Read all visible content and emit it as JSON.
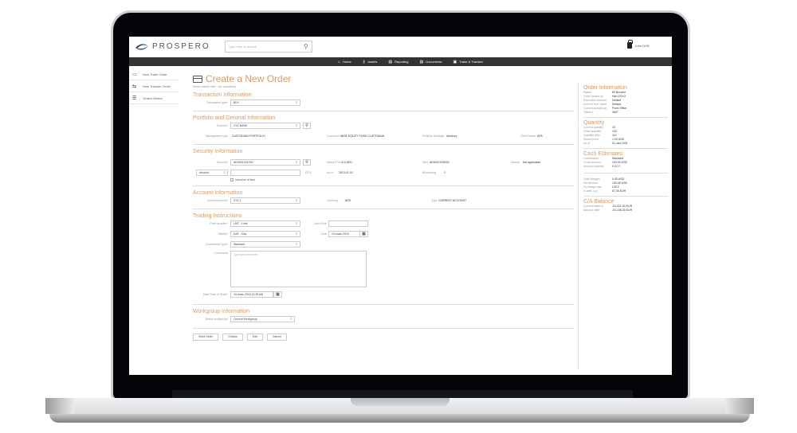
{
  "app": {
    "brand": "PROSPERO",
    "search_placeholder": "Type here to search",
    "user_name": "John DOE"
  },
  "nav": [
    {
      "icon": "home-icon",
      "glyph": "⌂",
      "label": "Home"
    },
    {
      "icon": "key-icon",
      "glyph": "⚷",
      "label": "Assets"
    },
    {
      "icon": "report-icon",
      "glyph": "▤",
      "label": "Reporting"
    },
    {
      "icon": "document-icon",
      "glyph": "▤",
      "label": "Documents"
    },
    {
      "icon": "briefcase-icon",
      "glyph": "▣",
      "label": "Trade & Transfer"
    }
  ],
  "sidebar": [
    {
      "icon": "card-icon",
      "glyph": "▭",
      "label": "New Trade Order"
    },
    {
      "icon": "transfer-icon",
      "glyph": "⇆",
      "label": "New Transfer Order"
    },
    {
      "icon": "list-icon",
      "glyph": "☰",
      "label": "Orders Blotter"
    }
  ],
  "page": {
    "title": "Create a New Order",
    "mandatory_note": "Items marked with * are mandatory"
  },
  "transaction": {
    "title": "Transaction Information",
    "type_label": "Transaction type*",
    "type_value": "BUY"
  },
  "portfolio": {
    "title": "Portfolio and General Information",
    "portfolio_label": "Portfolio*",
    "portfolio_value": "XYZ BANK",
    "mgmt_label": "Management type",
    "mgmt_value": "CUSTODIAN PORTFOLIO",
    "custodian_label": "Custodian",
    "custodian_value": "WISE EQUITY FUND CUSTODIAN",
    "pm_label": "Portfolio Manager",
    "pm_value": "Advisory",
    "client_label": "Client Name",
    "client_value": "APA"
  },
  "security": {
    "title": "Security Information",
    "security_label": "Security*",
    "security_value": "AEA001201030",
    "amount_select": "Amount",
    "ccy_label": "CCY",
    "inclusive_fees": "Inclusive of fees",
    "market_price_label": "Market Price",
    "market_price_value": "2.0 AED",
    "asof_label": "As of",
    "asof_value": "2013-01-01",
    "isin_label": "ISIN",
    "isin_value": "AEA001203030",
    "bloomberg_label": "Bloomberg",
    "bloomberg_value": "2",
    "market_label": "Market",
    "market_value": "Not applicable"
  },
  "account": {
    "title": "Account Information",
    "current_label": "Current account*",
    "current_value": "XYZ 1",
    "currency_label": "Currency",
    "currency_value": "AED",
    "type_label": "Type",
    "type_value": "CURRENT ACCOUNT"
  },
  "trading": {
    "title": "Trading Instructions",
    "price_q_label": "Price qualifier*",
    "price_q_value": "LMT - Limit",
    "limit_label": "Limit Price",
    "limit_value": "",
    "validity_label": "Validity*",
    "validity_value": "DAY - Day",
    "until_label": "Until",
    "until_value": "19-mars-2015",
    "commission_label": "Commission type*",
    "commission_value": "Standard",
    "comments_label": "Comments",
    "comments_placeholder": "Type your text here",
    "datetime_label": "Date/Time of Order*",
    "datetime_value": "19-mars-2015 11:35 AM"
  },
  "workgroup": {
    "title": "Workgroup Information",
    "select_label": "Select workgroup*",
    "select_value": "Current Workgroup"
  },
  "actions": [
    "Send Order",
    "Checks",
    "Edit",
    "Cancel"
  ],
  "order_info": {
    "title": "Order Information",
    "rows": [
      {
        "k": "Status",
        "v": "80 Booked"
      },
      {
        "k": "Order locked by",
        "v": "Han SOLO"
      },
      {
        "k": "Execution channel",
        "v": "Default"
      },
      {
        "k": "Current flow / label",
        "v": "Default"
      },
      {
        "k": "Current workgroup",
        "v": "Front Office"
      },
      {
        "k": "Ticket #",
        "v": "3697"
      }
    ]
  },
  "quantity": {
    "title": "Quantity",
    "rows": [
      {
        "k": "Current quantity",
        "v": "10"
      },
      {
        "k": "Order quantity",
        "v": "100"
      },
      {
        "k": "Quantity after",
        "v": "110"
      },
      {
        "k": "Stored price",
        "v": "1.00 USD"
      },
      {
        "k": "As of",
        "v": "01-Jan-1901"
      }
    ]
  },
  "cash": {
    "title": "Cash Estimates",
    "rows": [
      {
        "k": "Commission",
        "v": "Standard"
      },
      {
        "k": "Gross amount",
        "v": "100.00 USD"
      },
      {
        "k": "Accrued interest",
        "v": "0 CCY"
      }
    ],
    "rows2": [
      {
        "k": "Total charges",
        "v": "0.05 USD"
      },
      {
        "k": "Net amount",
        "v": "100.05 USD"
      },
      {
        "k": "Exchange rate",
        "v": "0.872"
      },
      {
        "k": "In settl. ccy",
        "v": "87.26 EUR"
      }
    ]
  },
  "ca_balance": {
    "title": "C/A Balance",
    "rows": [
      {
        "k": "Current balance",
        "v": "-51,021.04 EUR"
      },
      {
        "k": "Balance after",
        "v": "-51,108.30 EUR"
      }
    ]
  },
  "colors": {
    "accent": "#e09a62",
    "navbar": "#333333"
  }
}
